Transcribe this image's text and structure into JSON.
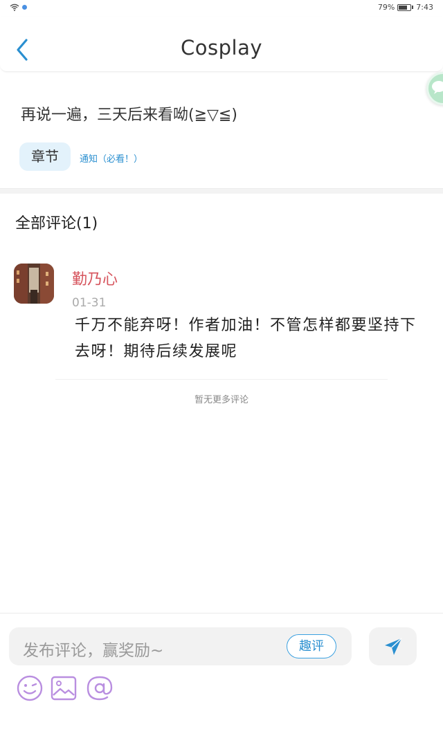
{
  "status_bar": {
    "battery": "79%",
    "time": "7:43"
  },
  "header": {
    "title": "Cosplay"
  },
  "chapter": {
    "text": "再说一遍，三天后来看呦(≧▽≦)",
    "tag_label": "章节",
    "notice_link": "通知（必看！）"
  },
  "comments": {
    "heading": "全部评论(1)",
    "items": [
      {
        "author": "勤乃心",
        "date": "01-31",
        "body": "千万不能弃呀！作者加油！不管怎样都要坚持下去呀！期待后续发展呢"
      }
    ],
    "no_more": "暂无更多评论"
  },
  "input": {
    "placeholder": "发布评论，赢奖励~",
    "fun_review_label": "趣评"
  },
  "colors": {
    "accent_blue": "#2a8fd0",
    "author_red": "#d6545d",
    "tag_bg": "#e3f2fb",
    "tool_purple": "#b98ee0"
  },
  "icons": [
    "wifi-icon",
    "back-arrow-icon",
    "chat-bubble-icon",
    "send-icon",
    "emoji-icon",
    "image-icon",
    "at-icon"
  ]
}
